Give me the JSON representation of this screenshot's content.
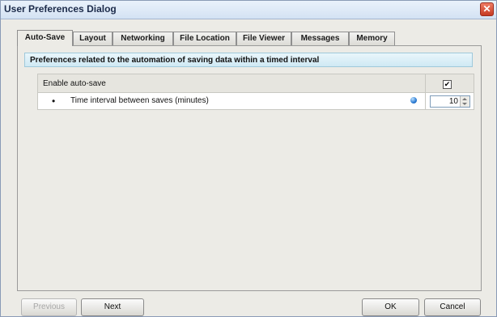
{
  "window": {
    "title": "User Preferences Dialog",
    "close_glyph": "✕"
  },
  "tabs": [
    {
      "label": "Auto-Save",
      "active": true
    },
    {
      "label": "Layout",
      "active": false
    },
    {
      "label": "Networking",
      "active": false
    },
    {
      "label": "File Location",
      "active": false
    },
    {
      "label": "File Viewer",
      "active": false
    },
    {
      "label": "Messages",
      "active": false
    },
    {
      "label": "Memory",
      "active": false
    }
  ],
  "panel": {
    "header": "Preferences related to the automation of saving data within a timed interval",
    "rows": [
      {
        "label": "Enable auto-save",
        "checked": true,
        "check_glyph": "✔"
      },
      {
        "bullet": "•",
        "label": "Time interval between saves (minutes)",
        "value": "10"
      }
    ]
  },
  "buttons": {
    "previous": "Previous",
    "next": "Next",
    "ok": "OK",
    "cancel": "Cancel"
  },
  "colors": {
    "title_bar": "#d3e2f3",
    "close_button": "#c53a22",
    "header_bar": "#cfe9f4",
    "info_dot": "#2a7bd3"
  }
}
